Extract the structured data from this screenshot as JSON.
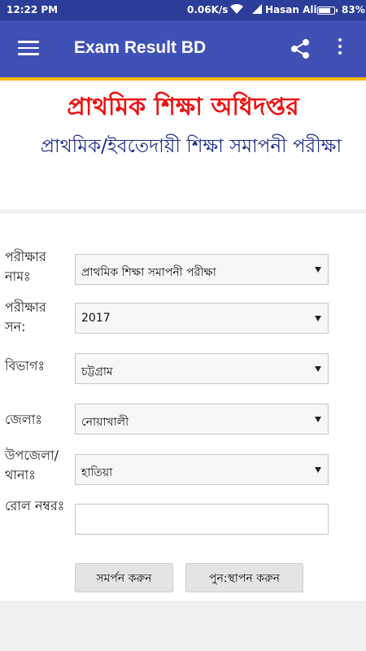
{
  "status_bar": {
    "time": "12:22 PM",
    "net_speed": "0.06K/s",
    "carrier": "Hasan Ali",
    "battery_percent": "83%",
    "battery_level": 0.83
  },
  "app_bar": {
    "title": "Exam Result BD",
    "color": "#3f51b5"
  },
  "header": {
    "title": "প্রাথমিক শিক্ষা অধিদপ্তর",
    "subtitle": "প্রাথমিক/ইবতেদায়ী শিক্ষা সমাপনী পরীক্ষা",
    "title_color": "#ee1111",
    "subtitle_color": "#1c2a8a"
  },
  "form": {
    "exam_name": {
      "label": "পরীক্ষার নামঃ",
      "value": "প্রাথমিক শিক্ষা সমাপনী পরীক্ষা"
    },
    "exam_year": {
      "label": "পরীক্ষার সন:",
      "value": "2017"
    },
    "division": {
      "label": "বিভাগঃ",
      "value": "চট্টগ্রাম"
    },
    "district": {
      "label": "জেলাঃ",
      "value": "নোয়াখালী"
    },
    "upazila": {
      "label": "উপজেলা/থানাঃ",
      "value": "হাতিয়া"
    },
    "roll": {
      "label": "রোল নম্বরঃ",
      "value": ""
    },
    "submit_label": "সমর্পন করুন",
    "reset_label": "পুন:স্থাপন করুন"
  }
}
